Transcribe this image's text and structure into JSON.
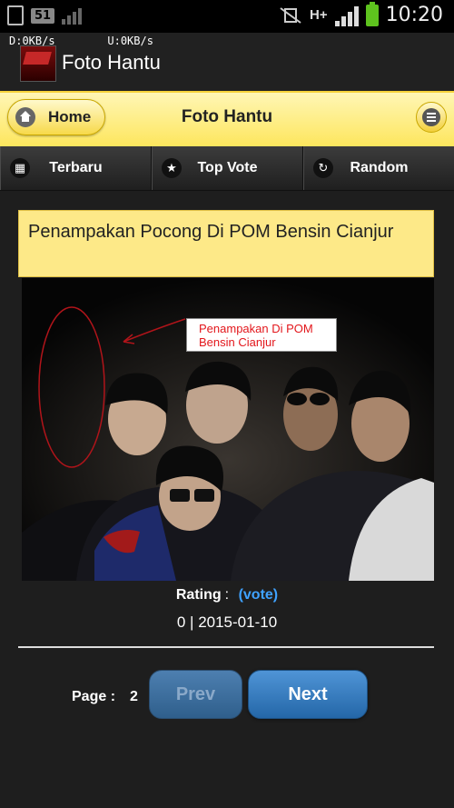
{
  "status_bar": {
    "notification_count": "51",
    "network_type": "H+",
    "time": "10:20",
    "download_speed": "D:0KB/s",
    "upload_speed": "U:0KB/s"
  },
  "app_bar": {
    "title": "Foto Hantu",
    "logo_text": "FOTO HANTU"
  },
  "header": {
    "home_label": "Home",
    "title": "Foto Hantu"
  },
  "nav": {
    "items": [
      {
        "label": "Terbaru",
        "icon": "grid-icon"
      },
      {
        "label": "Top Vote",
        "icon": "star-icon"
      },
      {
        "label": "Random",
        "icon": "refresh-icon"
      }
    ]
  },
  "post": {
    "title": "Penampakan Pocong Di POM Bensin Cianjur",
    "image_caption": "Penampakan Di POM Bensin Cianjur",
    "rating_label": "Rating",
    "vote_label": "(vote)",
    "votes": "0",
    "date": "2015-01-10"
  },
  "pager": {
    "page_label": "Page :",
    "current_page": "2",
    "prev_label": "Prev",
    "next_label": "Next"
  },
  "colors": {
    "header_yellow": "#fde65c",
    "title_box": "#fde988",
    "link_blue": "#3fa2ff",
    "next_button": "#2f7ac2",
    "caption_red": "#e3171c"
  }
}
